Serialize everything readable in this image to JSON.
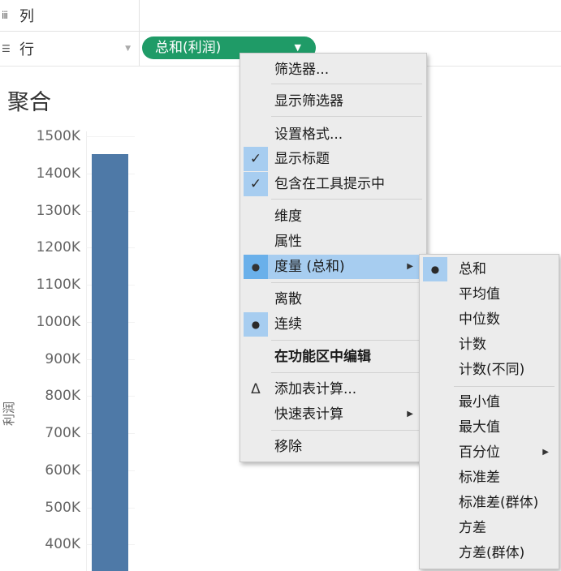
{
  "shelves": {
    "columns": {
      "icon": "iii",
      "label": "列"
    },
    "rows": {
      "icon": "☰",
      "label": "行",
      "caret": "▼",
      "pill_label": "总和(利润)",
      "pill_caret": "▼"
    }
  },
  "sheet": {
    "title": "聚合"
  },
  "chart_data": {
    "type": "bar",
    "categories": [
      ""
    ],
    "values": [
      1450
    ],
    "ylabel": "利润",
    "yunit": "K",
    "ylim": [
      300,
      1500
    ],
    "yticks": [
      1500,
      1400,
      1300,
      1200,
      1100,
      1000,
      900,
      800,
      700,
      600,
      500,
      400
    ],
    "ytick_labels": [
      "1500K",
      "1400K",
      "1300K",
      "1200K",
      "1100K",
      "1000K",
      "900K",
      "800K",
      "700K",
      "600K",
      "500K",
      "400K"
    ],
    "color": "#4e79a7"
  },
  "context_menu": {
    "items": {
      "filter": "筛选器...",
      "show_filter": "显示筛选器",
      "format": "设置格式...",
      "show_header": "显示标题",
      "include_tooltip": "包含在工具提示中",
      "dimension": "维度",
      "attribute": "属性",
      "measure": "度量 (总和)",
      "discrete": "离散",
      "continuous": "连续",
      "edit_in_shelf": "在功能区中编辑",
      "add_table_calc": "添加表计算...",
      "quick_table_calc": "快速表计算",
      "remove": "移除"
    },
    "check_glyph": "✓",
    "bullet_glyph": "●",
    "delta_glyph": "Δ",
    "submenu_glyph": "▶"
  },
  "measure_submenu": {
    "items": {
      "sum": "总和",
      "average": "平均值",
      "median": "中位数",
      "count": "计数",
      "count_distinct": "计数(不同)",
      "min": "最小值",
      "max": "最大值",
      "percentile": "百分位",
      "stdev": "标准差",
      "stdev_pop": "标准差(群体)",
      "variance": "方差",
      "variance_pop": "方差(群体)"
    }
  },
  "colors": {
    "pill": "#1f9b67",
    "highlight": "#a7cdf0",
    "bar": "#4e79a7",
    "menu_bg": "#ececec"
  }
}
